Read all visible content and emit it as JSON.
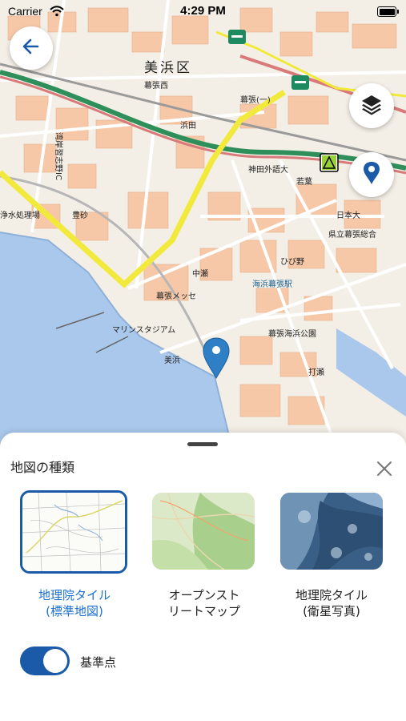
{
  "status": {
    "carrier": "Carrier",
    "time": "4:29 PM"
  },
  "map": {
    "labels": {
      "ward": "美浜区",
      "makuhari_nishi": "幕張西",
      "hamada": "浜田",
      "toyosuna": "豊砂",
      "nakase": "中瀬",
      "hibino": "ひび野",
      "wakaba": "若葉",
      "kanda_gaigo": "神田外語大",
      "makuhari_messe": "幕張メッセ",
      "marine_stadium": "マリンスタジアム",
      "mihama": "美浜",
      "uchiboku": "打瀬",
      "kaihin_makuhari_st": "海浜幕張駅",
      "makuhari_koen": "幕張海浜公園",
      "sewage": "浄水処理場",
      "highway_ic": "湾岸習志野IC",
      "school": "県立幕張総合",
      "sakura_dai": "日本大",
      "makuhari_hongo": "幕張(一)"
    },
    "colors": {
      "land": "#f4efe6",
      "water": "#aac8ec",
      "block": "#f6c8a8",
      "highway": "#2f8f5a",
      "yellow_road": "#f1ea3c"
    }
  },
  "sheet": {
    "title": "地図の種類",
    "tiles": [
      {
        "label_line1": "地理院タイル",
        "label_line2": "(標準地図)",
        "selected": true
      },
      {
        "label_line1": "オープンスト",
        "label_line2": "リートマップ",
        "selected": false
      },
      {
        "label_line1": "地理院タイル",
        "label_line2": "(衛星写真)",
        "selected": false
      }
    ],
    "toggle": {
      "label": "基準点",
      "on": true
    }
  },
  "icons": {
    "back": "arrow-left-icon",
    "layers": "layers-icon",
    "location": "location-pin-icon",
    "close": "close-icon"
  }
}
